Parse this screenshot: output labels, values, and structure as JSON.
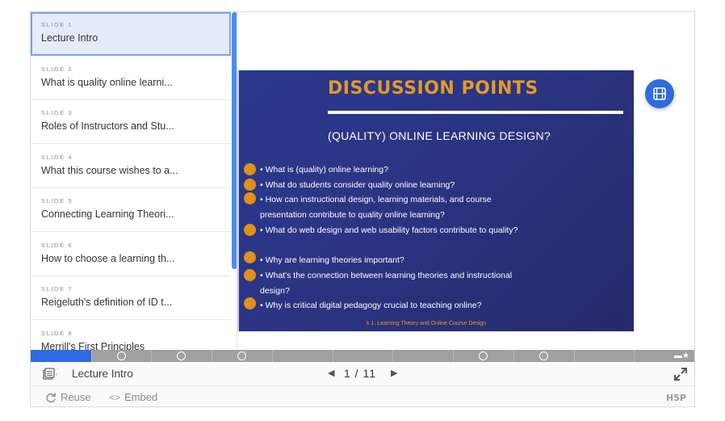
{
  "slide": {
    "title": "DISCUSSION POINTS",
    "subtitle": "(QUALITY) ONLINE LEARNING DESIGN?",
    "bullets": [
      "• What is (quality) online learning?",
      "• What do students consider quality online learning?",
      "• How can instructional design, learning materials, and course presentation contribute to quality online learning?",
      "• What do web design and web usability factors contribute to quality?",
      "• Why are learning theories important?",
      "• What's the connection between learning theories and instructional design?",
      "• Why is critical digital pedagogy crucial to teaching online?"
    ],
    "footer": "k 1: Learning Theory and Online Course Design",
    "accent_color": "#e39a2a",
    "background_color": "#2a3584"
  },
  "menu": {
    "items": [
      {
        "label": "SLIDE 1",
        "text": "Lecture Intro"
      },
      {
        "label": "SLIDE 2",
        "text": "What is quality online learni..."
      },
      {
        "label": "SLIDE 3",
        "text": "Roles of Instructors and Stu..."
      },
      {
        "label": "SLIDE 4",
        "text": "What this course wishes to a..."
      },
      {
        "label": "SLIDE 5",
        "text": "Connecting Learning Theori..."
      },
      {
        "label": "SLIDE 6",
        "text": "How to choose a learning th..."
      },
      {
        "label": "SLIDE 7",
        "text": "Reigeluth's definition of ID t..."
      },
      {
        "label": "SLIDE 8",
        "text": "Merrill's First Principles"
      }
    ]
  },
  "progress": {
    "current": 1,
    "total": 11,
    "fill_fraction": 0.0909
  },
  "navbar": {
    "title": "Lecture Intro",
    "counter": "1 / 11",
    "prev_icon": "chevron-left-icon",
    "next_icon": "chevron-right-icon"
  },
  "actions": {
    "reuse": "Reuse",
    "embed": "Embed",
    "logo": "H5P"
  },
  "colors": {
    "primary": "#2f6be0",
    "active_item_bg": "#e4ebfa"
  }
}
